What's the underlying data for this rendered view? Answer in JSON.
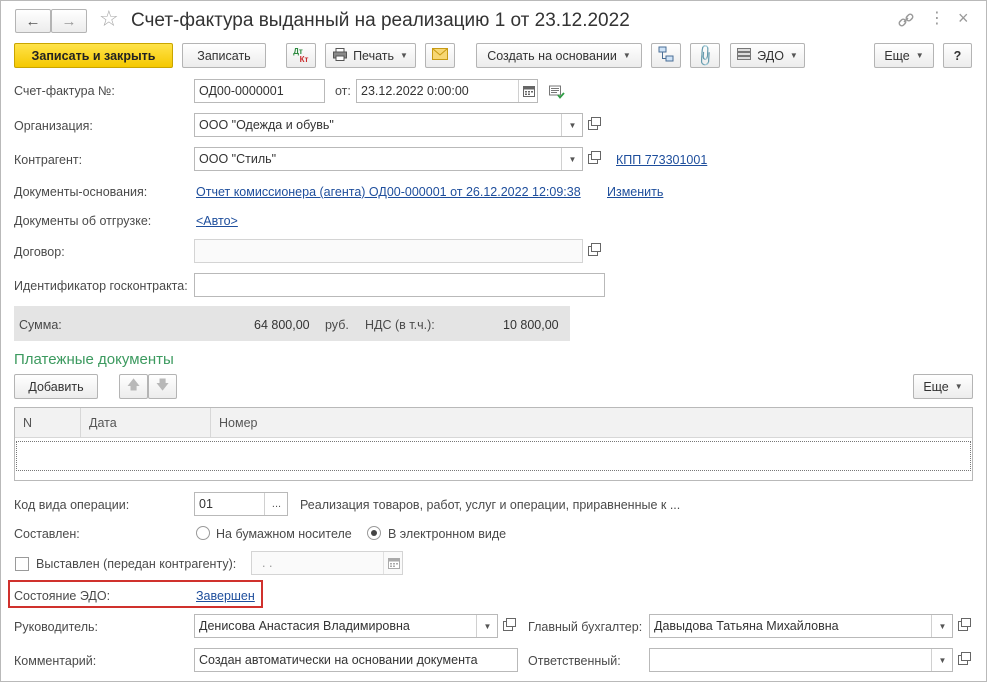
{
  "title": "Счет-фактура выданный на реализацию 1 от 23.12.2022",
  "toolbar": {
    "save_close": "Записать и закрыть",
    "save": "Записать",
    "dt_kt_top": "Дт",
    "dt_kt_bottom": "Кт",
    "print": "Печать",
    "create_based": "Создать на основании",
    "edo": "ЭДО",
    "more": "Еще",
    "help": "?"
  },
  "form": {
    "invoice_no_label": "Счет-фактура №:",
    "invoice_no": "ОД00-0000001",
    "from_label": "от:",
    "date": "23.12.2022  0:00:00",
    "org_label": "Организация:",
    "org": "ООО \"Одежда и обувь\"",
    "contractor_label": "Контрагент:",
    "contractor": "ООО \"Стиль\"",
    "kpp_link": "КПП 773301001",
    "basis_label": "Документы-основания:",
    "basis_link": "Отчет комиссионера (агента) ОД00-000001 от 26.12.2022 12:09:38",
    "change_link": "Изменить",
    "shipment_label": "Документы об отгрузке:",
    "shipment_link": "<Авто>",
    "contract_label": "Договор:",
    "contract": "",
    "gov_id_label": "Идентификатор госконтракта:",
    "gov_id": "",
    "sum_label": "Сумма:",
    "sum": "64 800,00",
    "currency": "руб.",
    "vat_label": "НДС (в т.ч.):",
    "vat": "10 800,00"
  },
  "payments": {
    "title": "Платежные документы",
    "add": "Добавить",
    "more": "Еще",
    "columns": [
      "N",
      "Дата",
      "Номер"
    ]
  },
  "bottom": {
    "op_code_label": "Код вида операции:",
    "op_code": "01",
    "op_code_btn": "...",
    "op_code_desc": "Реализация товаров, работ, услуг и операции, приравненные к ...",
    "composed_label": "Составлен:",
    "paper": "На бумажном носителе",
    "electronic": "В электронном виде",
    "issued_label": "Выставлен (передан контрагенту):",
    "issued_date": " .  .",
    "edo_state_label": "Состояние ЭДО:",
    "edo_state": "Завершен",
    "head_label": "Руководитель:",
    "head": "Денисова Анастасия Владимировна",
    "accountant_label": "Главный бухгалтер:",
    "accountant": "Давыдова Татьяна Михайловна",
    "comment_label": "Комментарий:",
    "comment": "Создан автоматически на основании документа",
    "responsible_label": "Ответственный:",
    "responsible": ""
  },
  "colors": {
    "primary_yellow": "#f5c800",
    "link_blue": "#1e4e9c",
    "section_green": "#3c9a5f",
    "highlight_red": "#d0312d"
  }
}
